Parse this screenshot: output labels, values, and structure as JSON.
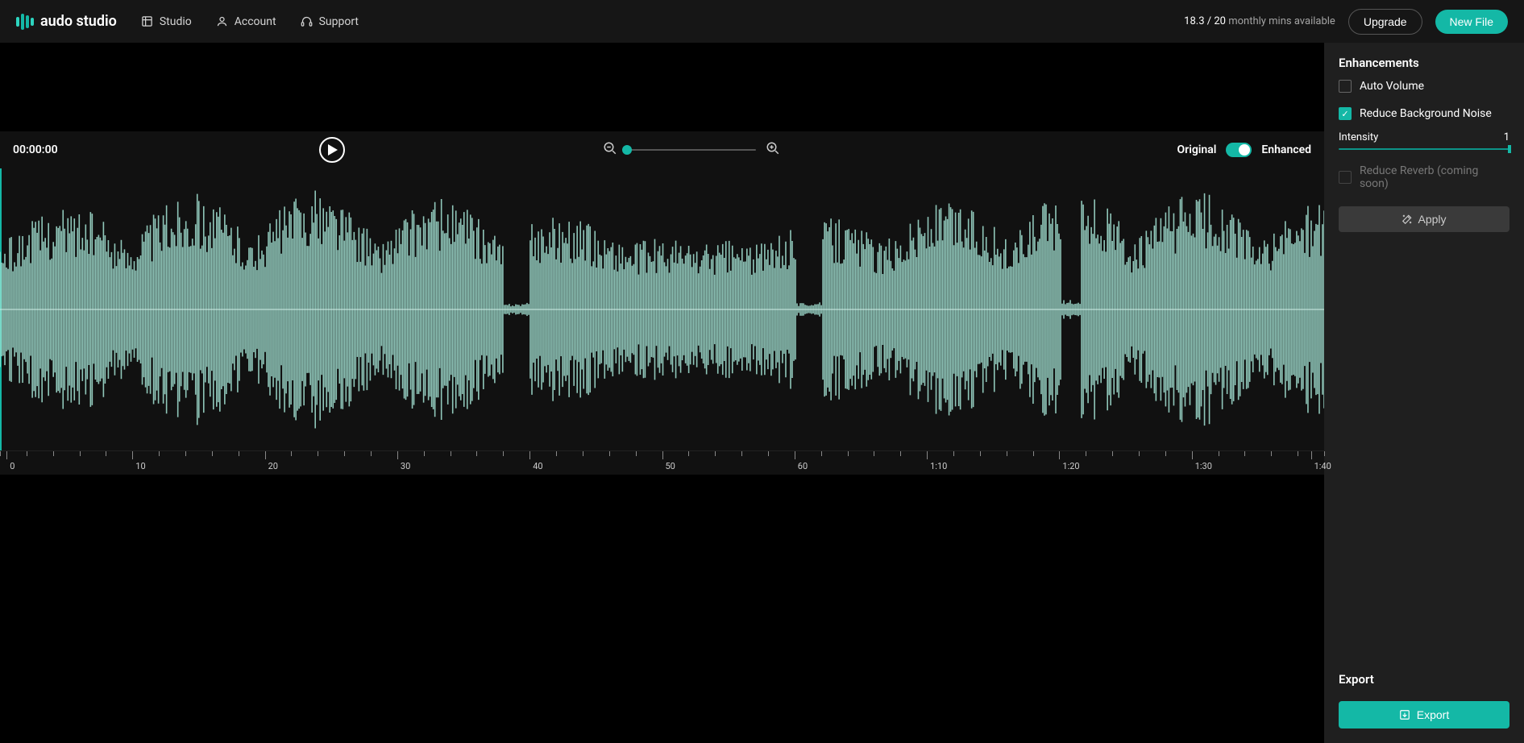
{
  "brand": "audo studio",
  "nav": {
    "studio": "Studio",
    "account": "Account",
    "support": "Support"
  },
  "usage": {
    "used": "18.3",
    "separator": " / ",
    "total": "20",
    "label": " monthly mins available"
  },
  "buttons": {
    "upgrade": "Upgrade",
    "newfile": "New File"
  },
  "player": {
    "timecode": "00:00:00",
    "original": "Original",
    "enhanced": "Enhanced"
  },
  "ruler": {
    "marks": [
      "0",
      "10",
      "20",
      "30",
      "40",
      "50",
      "60",
      "1:10",
      "1:20",
      "1:30",
      "1:40"
    ],
    "positions_pct": [
      0.5,
      10,
      20,
      30,
      40,
      50,
      60,
      70,
      80,
      90,
      99
    ]
  },
  "sidebar": {
    "enh_title": "Enhancements",
    "auto_volume": "Auto Volume",
    "reduce_noise": "Reduce Background Noise",
    "intensity_label": "Intensity",
    "intensity_value": "1",
    "reduce_reverb": "Reduce Reverb (coming soon)",
    "apply": "Apply",
    "export_title": "Export",
    "export_btn": "Export"
  }
}
